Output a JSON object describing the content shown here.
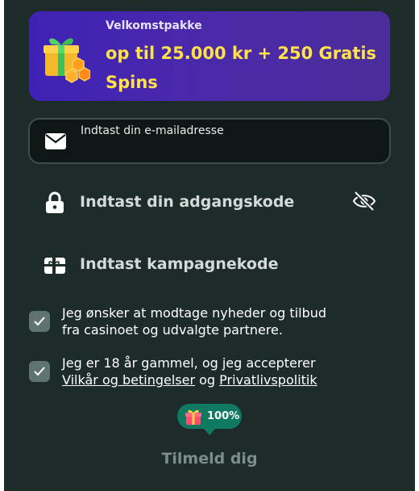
{
  "banner": {
    "kicker": "Velkomstpakke",
    "offer": "op til 25.000 kr + 250 Gratis Spins",
    "icon": "gift-box-icon"
  },
  "email": {
    "label": "Indtast din e-mailadresse",
    "value": "",
    "icon": "envelope-icon"
  },
  "password": {
    "placeholder": "Indtast din adgangskode",
    "icon": "lock-icon",
    "toggle_icon": "eye-slash-icon"
  },
  "promo": {
    "placeholder": "Indtast kampagnekode",
    "icon": "gift-card-icon"
  },
  "consents": [
    {
      "checked": true,
      "line1": "Jeg ønsker at modtage nyheder og tilbud",
      "line2": "fra casinoet og udvalgte partnere."
    },
    {
      "checked": true,
      "line1": "Jeg er 18 år gammel, og jeg accepterer",
      "terms_link": "Vilkår og betingelser",
      "conjunction": "og",
      "privacy_link": "Privatlivspolitik"
    }
  ],
  "bonus_badge": {
    "text": "100%",
    "icon": "gift-icon"
  },
  "submit": {
    "label": "Tilmeld dig"
  },
  "colors": {
    "background": "#1d2c2a",
    "banner_gradient_start": "#3f22b5",
    "banner_gradient_end": "#4a2d9a",
    "offer_text": "#ffe14a",
    "badge": "#0f7a61",
    "button_text_disabled": "#7b8e8b"
  }
}
